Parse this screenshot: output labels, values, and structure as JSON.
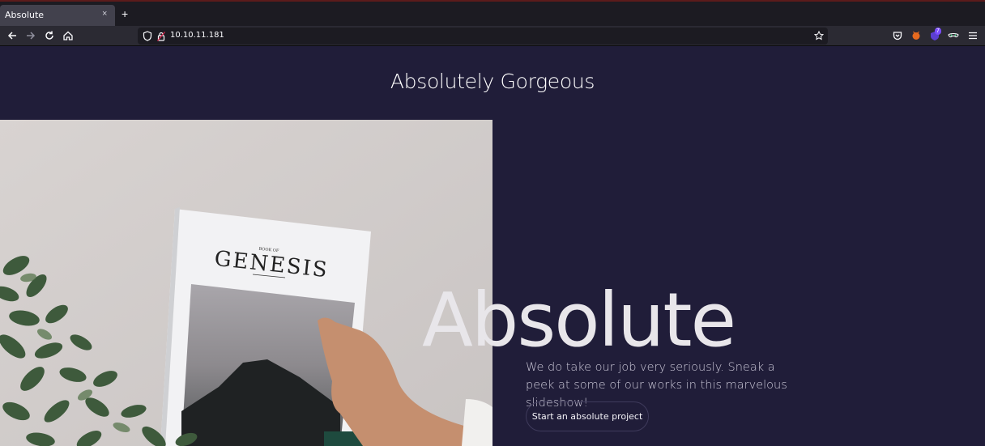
{
  "browser": {
    "tab_title": "Absolute",
    "tab_close": "×",
    "new_tab": "+",
    "url": "10.10.11.181",
    "extension_badge": "7",
    "icons": [
      "back-icon",
      "forward-icon",
      "reload-icon",
      "home-icon",
      "shield-icon",
      "lock-icon",
      "bookmark-star-icon",
      "pocket-icon",
      "extension-fox-icon",
      "extension-badge-icon",
      "extension-mask-icon",
      "menu-icon"
    ]
  },
  "site": {
    "title": "Absolutely Gorgeous",
    "hero_heading": "Absolute",
    "hero_text": "We do take our job very seriously. Sneak a peek at some of our works in this marvelous slideshow!",
    "cta_label": "Start an absolute project",
    "book_title": "GENESIS",
    "book_subtitle": "BOOK OF"
  },
  "colors": {
    "page_bg": "#201d39",
    "accent_text": "#e8e6ea"
  }
}
